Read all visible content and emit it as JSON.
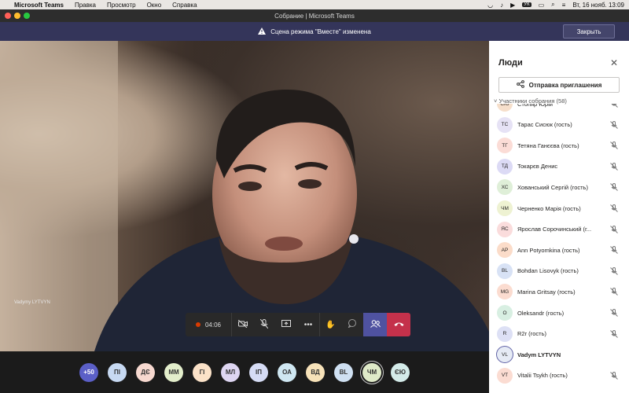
{
  "menubar": {
    "app_name": "Microsoft Teams",
    "menus": [
      "Правка",
      "Просмотр",
      "Окно",
      "Справка"
    ],
    "kbd": "УК",
    "datetime": "Вт, 16 нояб.  13:09"
  },
  "window": {
    "title": "Собрание | Microsoft Teams"
  },
  "notification": {
    "text": "Сцена режима \"Вместе\" изменена",
    "close_label": "Закрыть"
  },
  "video": {
    "caption": "Vadymy LYTVYN"
  },
  "toolbar": {
    "timer": "04:06"
  },
  "bottom_bar": {
    "avatars": [
      {
        "initials": "+50",
        "color": "#5b5fc7",
        "text_color": "#ffffff"
      },
      {
        "initials": "ПІ",
        "color": "#c7d9f2"
      },
      {
        "initials": "ДЄ",
        "color": "#f7d9d0"
      },
      {
        "initials": "ММ",
        "color": "#e3eecb"
      },
      {
        "initials": "ГІ",
        "color": "#fbe2c8"
      },
      {
        "initials": "МЛ",
        "color": "#ded6f2"
      },
      {
        "initials": "ІП",
        "color": "#d6dcf5"
      },
      {
        "initials": "ОА",
        "color": "#cfe7f2"
      },
      {
        "initials": "ВД",
        "color": "#f7e2b9"
      },
      {
        "initials": "BL",
        "color": "#cfe0f2"
      },
      {
        "initials": "ЧМ",
        "color": "#dfeac8",
        "selected": true
      },
      {
        "initials": "ЄЮ",
        "color": "#d4ebe9"
      }
    ]
  },
  "panel": {
    "title": "Люди",
    "invite_label": "Отправка приглашения",
    "section_label": "Участники собрания",
    "section_count": "(58)",
    "participants": [
      {
        "initials": "СЮ",
        "name": "Стопяр Юрій",
        "color": "#f6dfcb"
      },
      {
        "initials": "ТС",
        "name": "Тарас Сисюк (гость)",
        "color": "#e6e2f5"
      },
      {
        "initials": "ТГ",
        "name": "Тетяна Ганєєва (гость)",
        "color": "#fbdcd6"
      },
      {
        "initials": "ТД",
        "name": "Токарєв Денис",
        "color": "#dcdaf5"
      },
      {
        "initials": "ХС",
        "name": "Хованський Сергій (гость)",
        "color": "#dfefd8"
      },
      {
        "initials": "ЧМ",
        "name": "Черненко Марія (гость)",
        "color": "#eef2d2"
      },
      {
        "initials": "ЯС",
        "name": "Ярослав Сорочинський (г...",
        "color": "#fadcdc"
      },
      {
        "initials": "AP",
        "name": "Ann Potyomkina (гость)",
        "color": "#fbdcc9"
      },
      {
        "initials": "BL",
        "name": "Bohdan Lisovyk (гость)",
        "color": "#d8e2f5"
      },
      {
        "initials": "MG",
        "name": "Marina Gritsay (гость)",
        "color": "#fbdcd0"
      },
      {
        "initials": "O",
        "name": "Oleksandr (гость)",
        "color": "#d8efe2"
      },
      {
        "initials": "R",
        "name": "R2r (гость)",
        "color": "#dde0f5"
      },
      {
        "initials": "VL",
        "name": "Vadym LYTVYN",
        "color": "#e6ebf5",
        "bold": true,
        "self": true
      },
      {
        "initials": "VT",
        "name": "Vitalii Tsykh (гость)",
        "color": "#fbdcd2"
      }
    ]
  }
}
